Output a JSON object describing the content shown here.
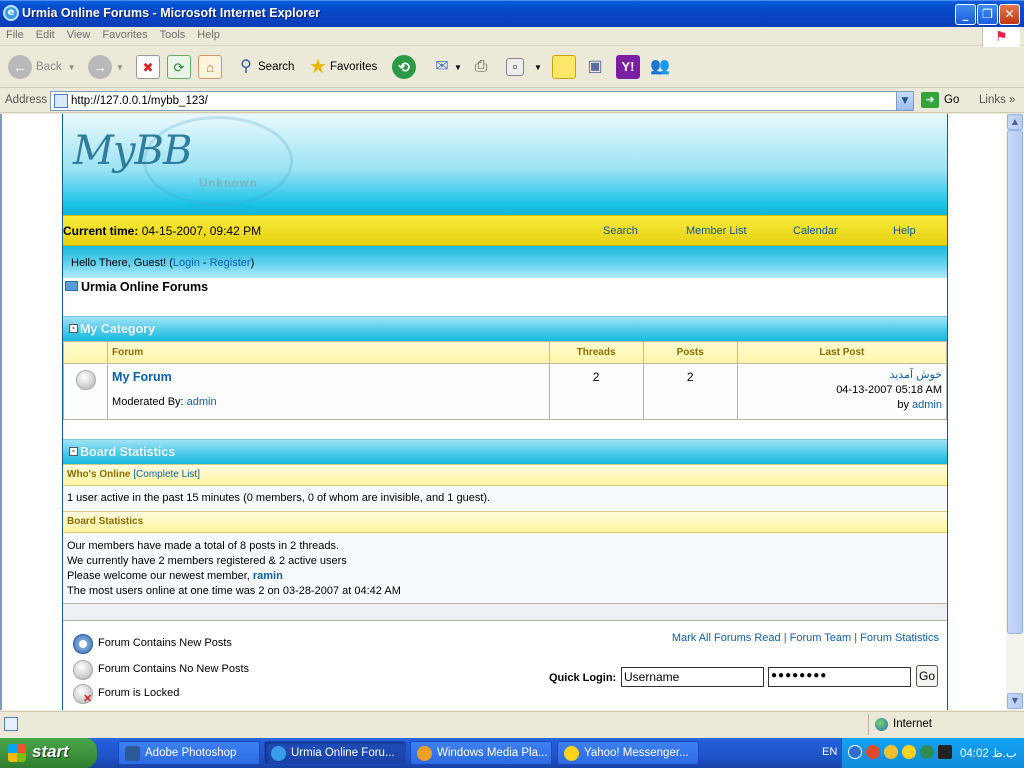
{
  "window": {
    "title": "Urmia Online Forums - Microsoft Internet Explorer"
  },
  "menu": [
    "File",
    "Edit",
    "View",
    "Favorites",
    "Tools",
    "Help"
  ],
  "toolbar": {
    "back": "Back",
    "search": "Search",
    "favorites": "Favorites"
  },
  "address": {
    "label": "Address",
    "url": "http://127.0.0.1/mybb_123/",
    "go": "Go",
    "links": "Links"
  },
  "header": {
    "logo": "MyBB",
    "tagline": "Unknown"
  },
  "navbar": {
    "current_time_label": "Current time:",
    "current_time": "04-15-2007, 09:42 PM",
    "links": [
      "Search",
      "Member List",
      "Calendar",
      "Help"
    ]
  },
  "guest": {
    "prefix": "Hello There, Guest! (",
    "login": "Login",
    "sep": " - ",
    "register": "Register",
    "suffix": ")"
  },
  "breadcrumb": "Urmia Online Forums",
  "category": {
    "title": "My Category",
    "columns": [
      "Forum",
      "Threads",
      "Posts",
      "Last Post"
    ],
    "forums": [
      {
        "name": "My Forum",
        "moderated_label": "Moderated By:",
        "moderator": "admin",
        "threads": "2",
        "posts": "2",
        "last_post_title": "خوش آمدید",
        "last_post_date": "04-13-2007 05:18 AM",
        "last_post_by_label": "by",
        "last_post_by": "admin"
      }
    ]
  },
  "stats": {
    "title": "Board Statistics",
    "whos_online_label": "Who's Online",
    "complete_list": "[Complete List]",
    "online_text": "1 user active in the past 15 minutes (0 members, 0 of whom are invisible, and 1 guest).",
    "board_stats_label": "Board Statistics",
    "line1": "Our members have made a total of 8 posts in 2 threads.",
    "line2": "We currently have 2 members registered & 2 active users",
    "line3_prefix": "Please welcome our newest member,",
    "newest_member": "ramin",
    "line4": "The most users online at one time was 2 on 03-28-2007 at 04:42 AM"
  },
  "legend": {
    "new_posts": "Forum Contains New Posts",
    "no_new_posts": "Forum Contains No New Posts",
    "locked": "Forum is Locked"
  },
  "footer_links": {
    "mark_read": "Mark All Forums Read",
    "team": "Forum Team",
    "stats": "Forum Statistics",
    "sep": "|"
  },
  "quick_login": {
    "label": "Quick Login:",
    "username": "Username",
    "password": "●●●●●●●●",
    "go": "Go"
  },
  "status": {
    "zone": "Internet"
  },
  "taskbar": {
    "start": "start",
    "tasks": [
      "Adobe Photoshop",
      "Urmia Online Foru...",
      "Windows Media Pla...",
      "Yahoo! Messenger..."
    ],
    "lang": "EN",
    "clock": "04:02 ب.ظ"
  }
}
